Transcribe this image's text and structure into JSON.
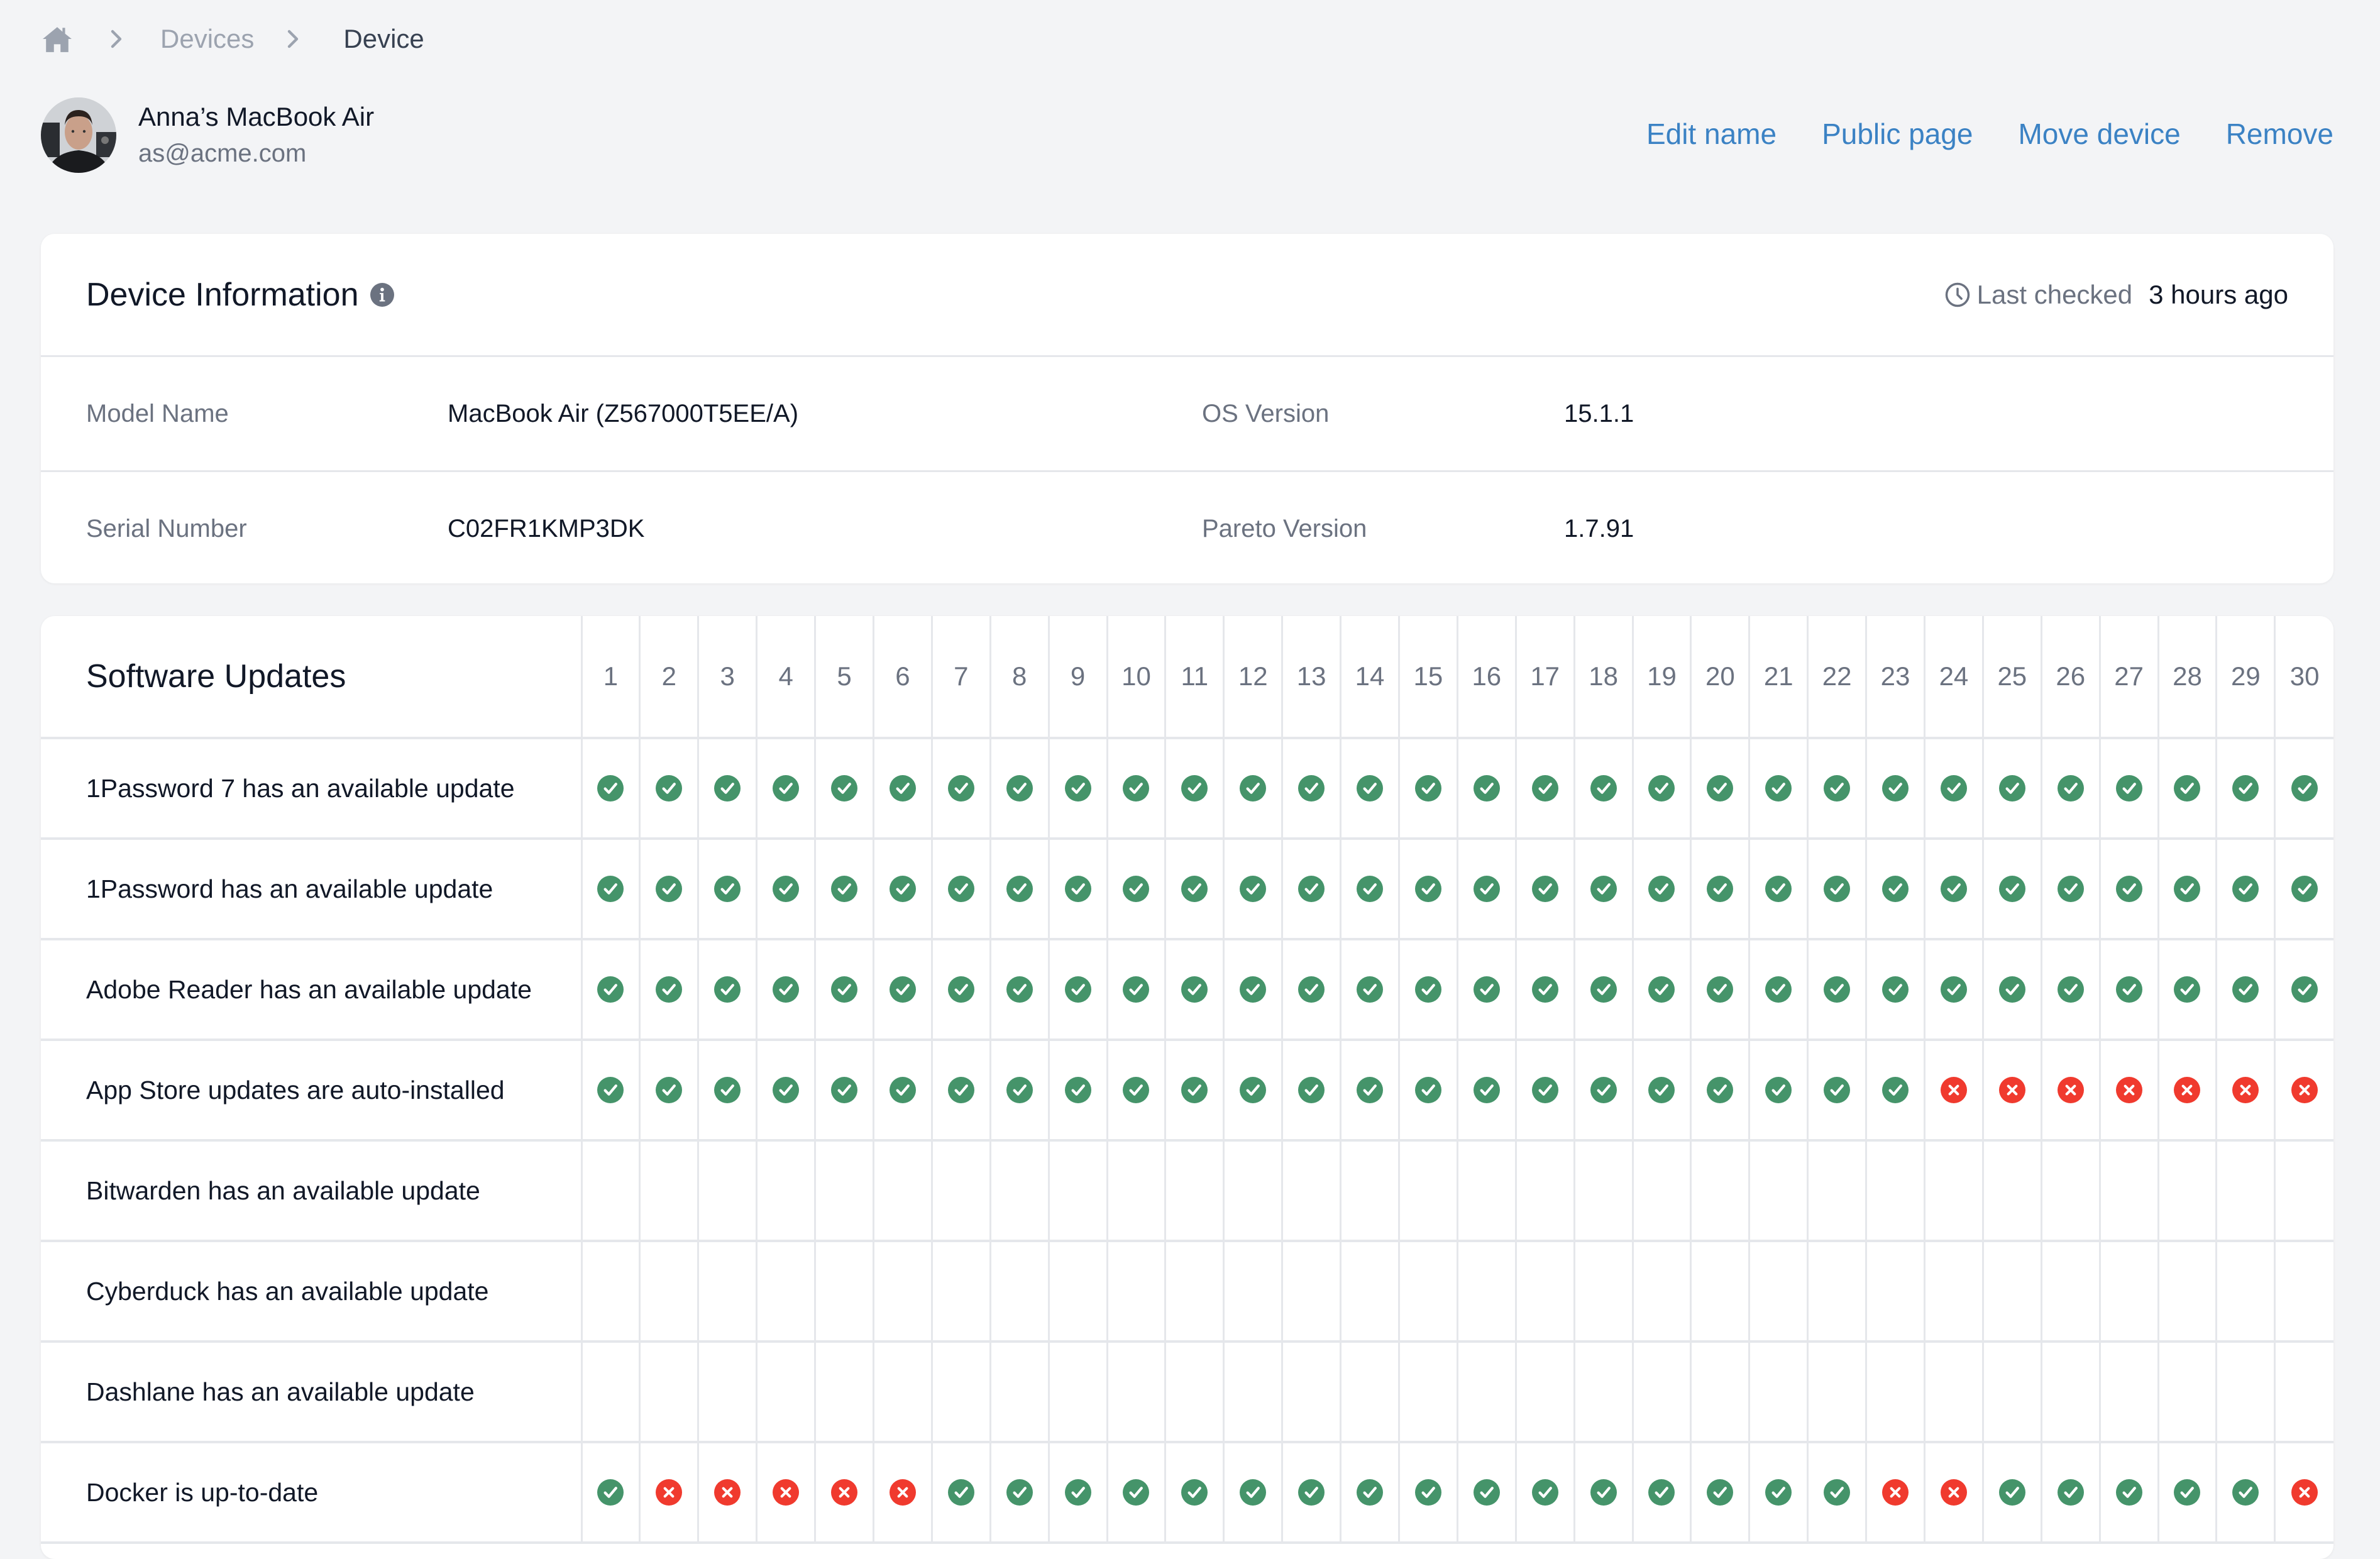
{
  "breadcrumb": {
    "home_icon": "home-icon",
    "separator_icon": "chevron-right-icon",
    "items": [
      "Devices",
      "Device"
    ]
  },
  "device": {
    "name": "Anna’s MacBook Air",
    "email": "as@acme.com",
    "avatar": "user-photo"
  },
  "actions": {
    "edit_name": "Edit name",
    "public_page": "Public page",
    "move_device": "Move device",
    "remove": "Remove"
  },
  "colors": {
    "link": "#3b82c4",
    "pass": "#45946a",
    "fail": "#f03a2e",
    "muted": "#6b7280",
    "background": "#f3f4f6"
  },
  "device_info": {
    "title": "Device Information",
    "info_icon": "info-icon",
    "last_checked_label": "Last checked",
    "last_checked_value": "3 hours ago",
    "rows": [
      {
        "label1": "Model Name",
        "value1": "MacBook Air (Z567000T5EE/A)",
        "label2": "OS Version",
        "value2": "15.1.1"
      },
      {
        "label1": "Serial Number",
        "value1": "C02FR1KMP3DK",
        "label2": "Pareto Version",
        "value2": "1.7.91"
      }
    ]
  },
  "software_updates": {
    "title": "Software Updates",
    "days": [
      "1",
      "2",
      "3",
      "4",
      "5",
      "6",
      "7",
      "8",
      "9",
      "10",
      "11",
      "12",
      "13",
      "14",
      "15",
      "16",
      "17",
      "18",
      "19",
      "20",
      "21",
      "22",
      "23",
      "24",
      "25",
      "26",
      "27",
      "28",
      "29",
      "30"
    ],
    "rows": [
      {
        "label": "1Password 7 has an available update",
        "status": "PPPPPPPPPPPPPPPPPPPPPPPPPPPPPP"
      },
      {
        "label": "1Password has an available update",
        "status": "PPPPPPPPPPPPPPPPPPPPPPPPPPPPPP"
      },
      {
        "label": "Adobe Reader has an available update",
        "status": "PPPPPPPPPPPPPPPPPPPPPPPPPPPPPP"
      },
      {
        "label": "App Store updates are auto-installed",
        "status": "PPPPPPPPPPPPPPPPPPPPPPPFFFFFFF"
      },
      {
        "label": "Bitwarden has an available update",
        "status": "------------------------------"
      },
      {
        "label": "Cyberduck has an available update",
        "status": "------------------------------"
      },
      {
        "label": "Dashlane has an available update",
        "status": "------------------------------"
      },
      {
        "label": "Docker is up-to-date",
        "status": "PFFFFFPPPPPPPPPPPPPPPPFFPPPPPF"
      }
    ],
    "legend": {
      "P": "pass",
      "F": "fail",
      "-": "no data"
    }
  }
}
